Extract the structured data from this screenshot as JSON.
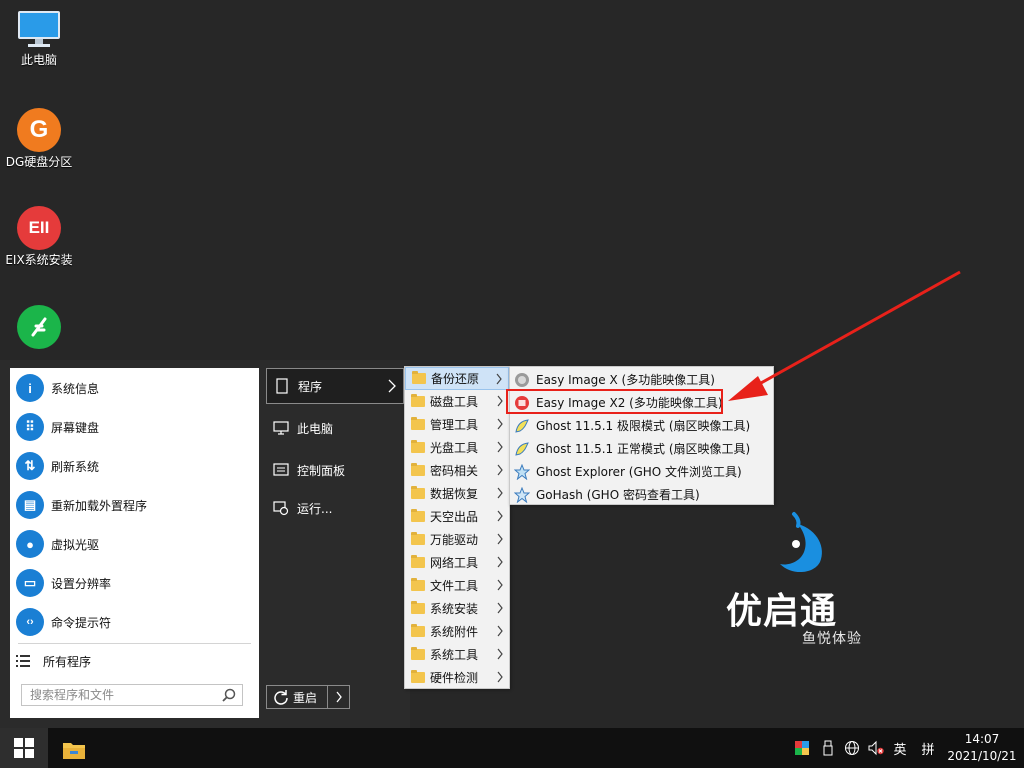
{
  "desktop": {
    "icons": [
      {
        "label": "此电脑",
        "icon": "monitor-icon"
      },
      {
        "label": "DG硬盘分区",
        "icon": "dg-partition-icon",
        "glyph": "G",
        "color": "#f07b1f"
      },
      {
        "label": "EIX系统安装",
        "icon": "eix-install-icon",
        "glyph": "EII",
        "color": "#e53b3b"
      },
      {
        "label": "",
        "icon": "green-tool-icon",
        "color": "#1bb54a"
      }
    ]
  },
  "brand": {
    "name": "优启通",
    "subtitle": "鱼悦体验",
    "accent": "#1a8fe0"
  },
  "start_menu": {
    "left_items": [
      {
        "label": "系统信息",
        "icon": "info-icon",
        "glyph": "i"
      },
      {
        "label": "屏幕键盘",
        "icon": "keyboard-icon",
        "glyph": "⠿"
      },
      {
        "label": "刷新系统",
        "icon": "refresh-icon",
        "glyph": "⇅"
      },
      {
        "label": "重新加载外置程序",
        "icon": "reload-icon",
        "glyph": "▤"
      },
      {
        "label": "虚拟光驱",
        "icon": "disc-icon",
        "glyph": "●"
      },
      {
        "label": "设置分辨率",
        "icon": "resolution-icon",
        "glyph": "▭"
      },
      {
        "label": "命令提示符",
        "icon": "cmd-icon",
        "glyph": "‹›"
      }
    ],
    "all_programs": "所有程序",
    "search_placeholder": "搜索程序和文件",
    "right_items": [
      {
        "label": "程序",
        "icon": "program-icon"
      },
      {
        "label": "此电脑",
        "icon": "computer-icon"
      },
      {
        "label": "控制面板",
        "icon": "control-panel-icon"
      },
      {
        "label": "运行...",
        "icon": "run-icon"
      }
    ],
    "restart": "重启"
  },
  "programs_submenu": [
    {
      "label": "备份还原"
    },
    {
      "label": "磁盘工具"
    },
    {
      "label": "管理工具"
    },
    {
      "label": "光盘工具"
    },
    {
      "label": "密码相关"
    },
    {
      "label": "数据恢复"
    },
    {
      "label": "天空出品"
    },
    {
      "label": "万能驱动"
    },
    {
      "label": "网络工具"
    },
    {
      "label": "文件工具"
    },
    {
      "label": "系统安装"
    },
    {
      "label": "系统附件"
    },
    {
      "label": "系统工具"
    },
    {
      "label": "硬件检测"
    }
  ],
  "backup_submenu": [
    {
      "label": "Easy Image X (多功能映像工具)",
      "icon": "easy-image-x-icon"
    },
    {
      "label": "Easy Image X2 (多功能映像工具)",
      "icon": "easy-image-x2-icon"
    },
    {
      "label": "Ghost 11.5.1 极限模式 (扇区映像工具)",
      "icon": "ghost-icon"
    },
    {
      "label": "Ghost 11.5.1 正常模式 (扇区映像工具)",
      "icon": "ghost-icon"
    },
    {
      "label": "Ghost Explorer (GHO 文件浏览工具)",
      "icon": "ghost-explorer-icon"
    },
    {
      "label": "GoHash (GHO 密码查看工具)",
      "icon": "gohash-icon"
    }
  ],
  "taskbar": {
    "ime_lang": "英",
    "ime_mode": "拼",
    "time": "14:07",
    "date": "2021/10/21"
  }
}
